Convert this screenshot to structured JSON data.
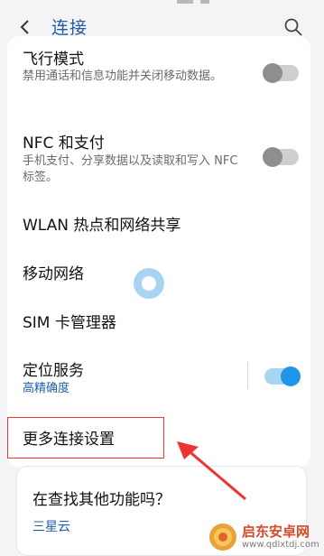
{
  "header": {
    "title": "连接",
    "back_icon": "chevron-left-icon",
    "search_icon": "search-icon"
  },
  "settings": [
    {
      "label": "飞行模式",
      "sub": "禁用通话和信息功能并关闭移动数据。",
      "toggle": "off"
    },
    {
      "label": "NFC 和支付",
      "sub": "手机支付、分享数据以及读取和写入 NFC 标签。",
      "toggle": "off"
    },
    {
      "label": "WLAN 热点和网络共享"
    },
    {
      "label": "移动网络"
    },
    {
      "label": "SIM 卡管理器"
    },
    {
      "label": "定位服务",
      "sub": "高精确度",
      "toggle": "on"
    },
    {
      "label": "更多连接设置"
    }
  ],
  "suggestion": {
    "question": "在查找其他功能吗？",
    "link": "三星云"
  },
  "watermark": {
    "name": "启东安卓网",
    "url": "www.qdlxtdj.com"
  },
  "colors": {
    "accent": "#1f5fa8",
    "toggle_on": "#2196e8",
    "highlight": "#e33333"
  }
}
